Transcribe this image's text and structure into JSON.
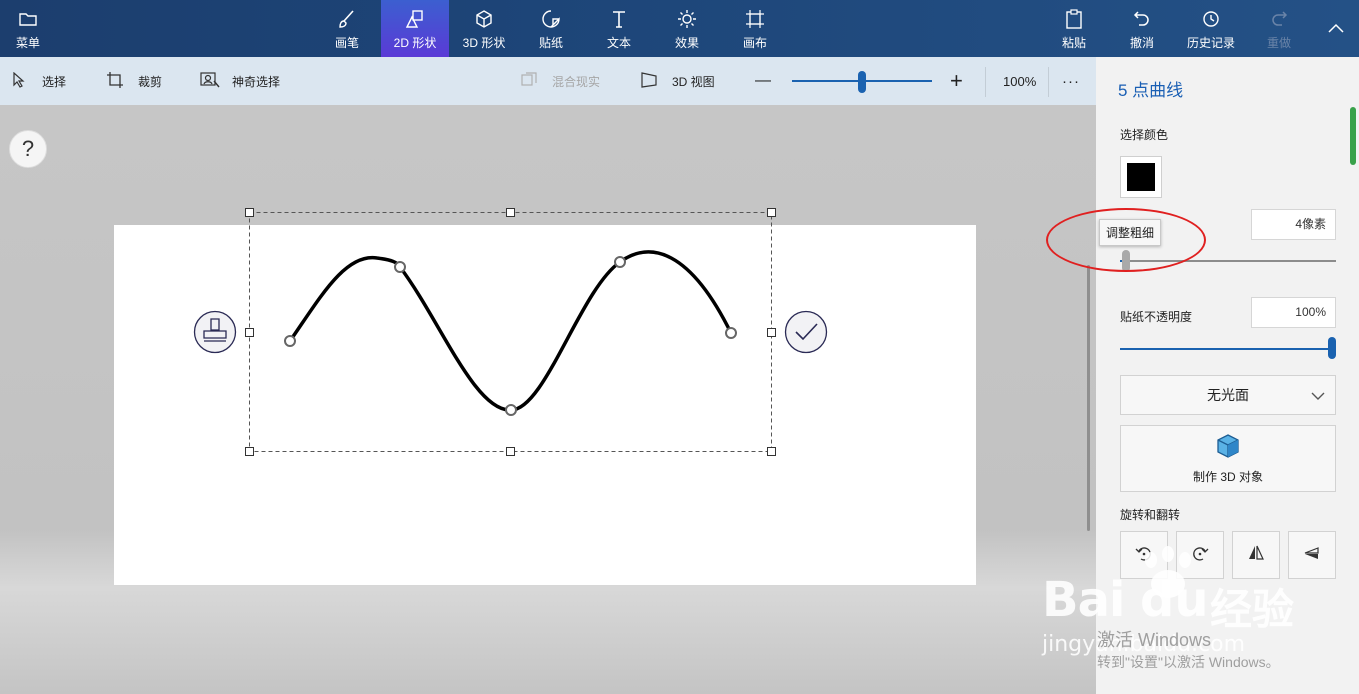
{
  "ribbon": {
    "menu_label": "菜单",
    "tools": [
      {
        "label": "画笔",
        "icon": "brush-icon"
      },
      {
        "label": "2D 形状",
        "icon": "2d-shapes-icon",
        "active": true
      },
      {
        "label": "3D 形状",
        "icon": "3d-shapes-icon"
      },
      {
        "label": "贴纸",
        "icon": "sticker-icon"
      },
      {
        "label": "文本",
        "icon": "text-icon"
      },
      {
        "label": "效果",
        "icon": "effects-icon"
      },
      {
        "label": "画布",
        "icon": "canvas-icon"
      }
    ],
    "right": [
      {
        "label": "粘贴",
        "icon": "paste-icon"
      },
      {
        "label": "撤消",
        "icon": "undo-icon"
      },
      {
        "label": "历史记录",
        "icon": "history-icon"
      },
      {
        "label": "重做",
        "icon": "redo-icon",
        "disabled": true
      }
    ]
  },
  "toolbar": {
    "select": "选择",
    "crop": "裁剪",
    "magic_select": "神奇选择",
    "mixed_reality": "混合现实",
    "view_3d": "3D 视图",
    "zoom_out": "—",
    "zoom_in": "+",
    "zoom_level": "100%",
    "zoom_fraction": 0.5,
    "more": "···"
  },
  "workspace": {
    "help": "?"
  },
  "panel": {
    "title": "5 点曲线",
    "color_label": "选择颜色",
    "selected_color": "#000000",
    "thickness_tooltip": "调整粗细",
    "thickness_value": "4像素",
    "thickness_fraction": 0.03,
    "opacity_label": "贴纸不透明度",
    "opacity_value": "100%",
    "opacity_fraction": 1.0,
    "finish": "无光面",
    "make3d": "制作 3D 对象",
    "rotate_label": "旋转和翻转"
  },
  "colors": {
    "accent": "#1a62b0",
    "ribbon": "#1d4578",
    "active_tab": "#4a4ad4",
    "annotation": "#e02020"
  },
  "watermark": {
    "baidu": "Bai",
    "baidu2": "du",
    "jingyan": "经验",
    "url": "jingyan.baidu.com",
    "activate_title": "激活 Windows",
    "activate_sub": "转到\"设置\"以激活 Windows。"
  }
}
